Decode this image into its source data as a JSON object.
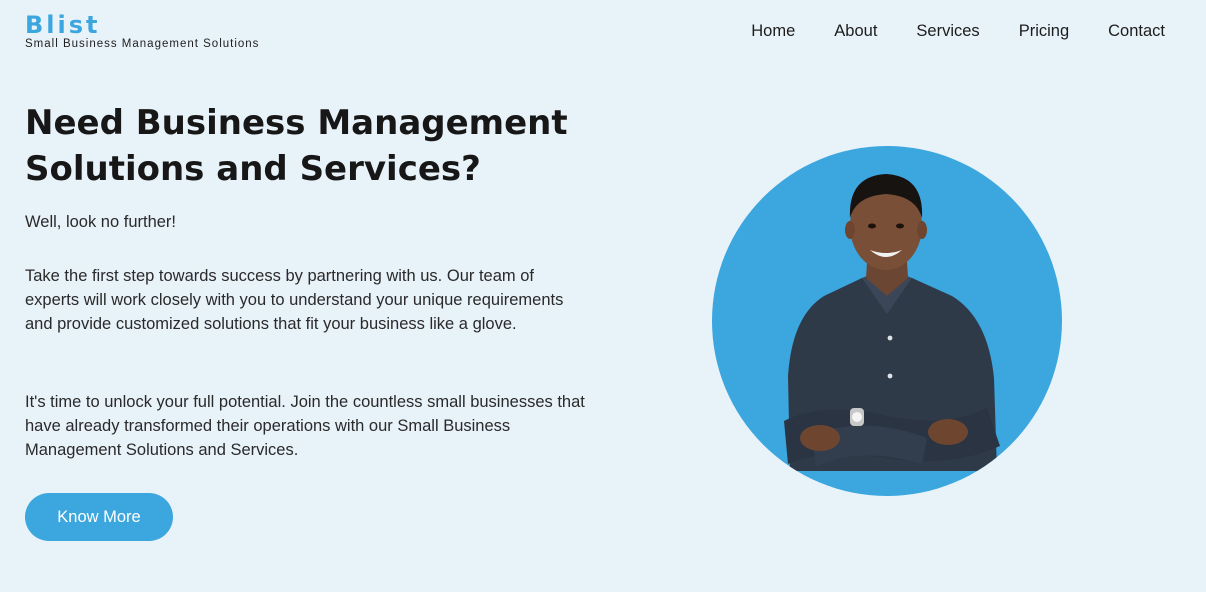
{
  "brand": {
    "name": "Blist",
    "tagline": "Small Business Management Solutions"
  },
  "nav": {
    "items": [
      "Home",
      "About",
      "Services",
      "Pricing",
      "Contact"
    ]
  },
  "hero": {
    "title": "Need Business Management Solutions and Services?",
    "paragraphs": [
      "Well, look no further!",
      "Take the first step towards success by partnering with us. Our team of experts will work closely with you to understand your unique requirements and provide customized solutions that fit your business like a glove.",
      "It's time to unlock your full potential. Join the countless small businesses that have already transformed their operations with our Small Business Management Solutions and Services."
    ],
    "cta_label": "Know More"
  },
  "colors": {
    "accent": "#3ca6df",
    "background": "#e8f2f9",
    "text": "#1b1b1b"
  },
  "portrait": {
    "icon": "person-photo"
  }
}
